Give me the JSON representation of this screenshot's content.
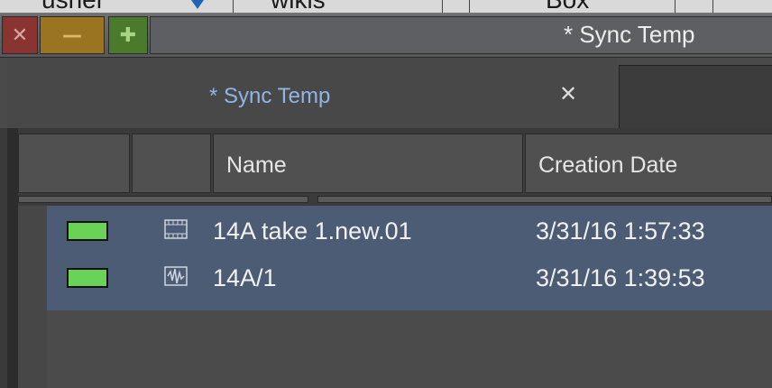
{
  "background_strip": {
    "segments": [
      "usher",
      "wikis",
      "Box"
    ]
  },
  "window": {
    "title": "* Sync Temp",
    "buttons": {
      "close_symbol": "✕",
      "minimize_symbol": "—",
      "maximize_symbol": "✚"
    }
  },
  "tabs": [
    {
      "label": "* Sync Temp",
      "close_symbol": "✕",
      "active": true
    }
  ],
  "columns": [
    {
      "label": ""
    },
    {
      "label": ""
    },
    {
      "label": "Name"
    },
    {
      "label": "Creation Date"
    }
  ],
  "rows": [
    {
      "color": "#6ad257",
      "icon": "sequence-icon",
      "name": "14A take 1.new.01",
      "date": "3/31/16 1:57:33"
    },
    {
      "color": "#6ad257",
      "icon": "audio-clip-icon",
      "name": "14A/1",
      "date": "3/31/16 1:39:53"
    }
  ],
  "colors": {
    "selected_row": "#4b5c74",
    "tab_label": "#8fb5e6",
    "close_button": "#8a3432",
    "minimize_button": "#9a7420",
    "maximize_button": "#4c7a2c"
  }
}
